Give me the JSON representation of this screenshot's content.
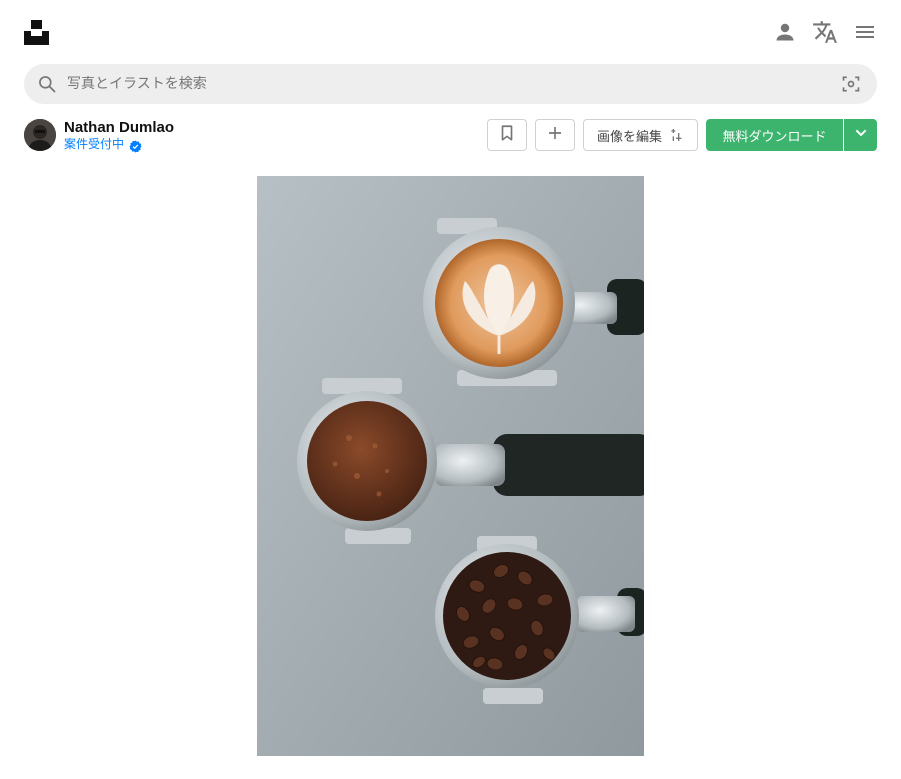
{
  "header": {
    "logo_icon": "unsplash-logo-icon",
    "icons": [
      "user-icon",
      "translate-icon",
      "menu-icon"
    ]
  },
  "search": {
    "placeholder": "写真とイラストを検索",
    "value": "",
    "left_icon": "search-icon",
    "right_icon": "visual-search-icon"
  },
  "photo_page": {
    "author": {
      "name": "Nathan Dumlao",
      "status": "案件受付中",
      "status_color": "#007fff",
      "badge_icon": "verified-icon"
    },
    "actions": {
      "bookmark_icon": "bookmark-icon",
      "add_icon": "plus-icon",
      "edit_label": "画像を編集",
      "edit_icon": "edit-sparkle-icon",
      "download_label": "無料ダウンロード",
      "download_color": "#3cb46e",
      "dropdown_icon": "chevron-down-icon"
    },
    "image": {
      "subject": "three espresso portafilters: latte art, ground coffee, coffee beans",
      "background_color": "#a7b0b5"
    }
  }
}
